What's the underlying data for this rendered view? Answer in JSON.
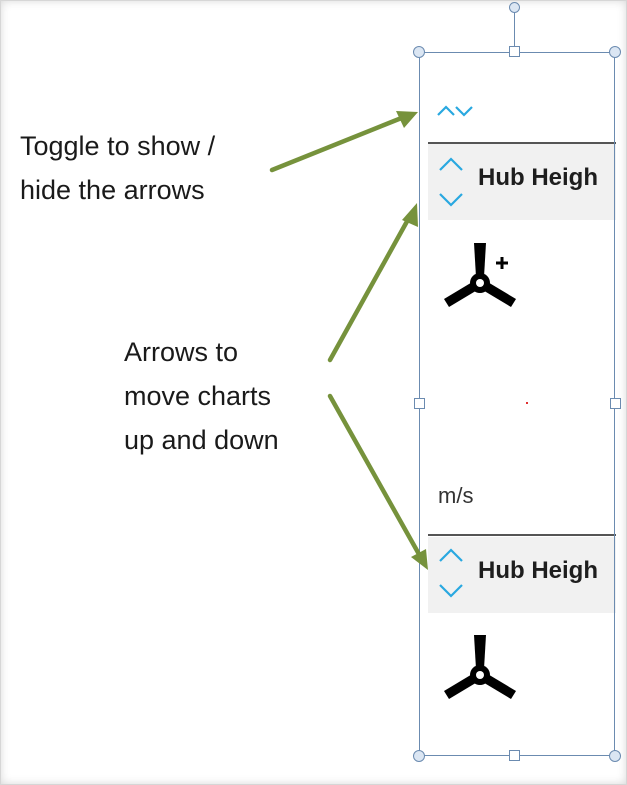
{
  "callouts": {
    "toggle_line1": "Toggle to show /",
    "toggle_line2": "hide the arrows",
    "arrows_line1": "Arrows to",
    "arrows_line2": "move charts",
    "arrows_line3": "up and down"
  },
  "panel": {
    "toggle_icon": "chevron-up-down-icon",
    "charts": [
      {
        "title": "Hub Heigh",
        "icon": "wind-turbine-add-icon",
        "unit": "m/s"
      },
      {
        "title": "Hub Heigh",
        "icon": "wind-turbine-icon"
      }
    ]
  },
  "colors": {
    "callout_arrow": "#76923c",
    "chevron": "#29a8e0",
    "selection": "#6b8bb0",
    "header_bg": "#f1f1f1"
  }
}
